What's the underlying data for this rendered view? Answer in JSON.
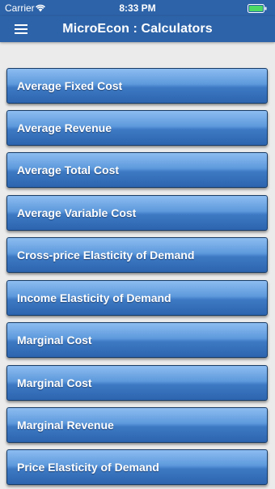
{
  "status_bar": {
    "carrier": "Carrier",
    "time": "8:33 PM",
    "icons": [
      "wifi-icon",
      "battery-icon"
    ]
  },
  "header": {
    "title": "MicroEcon : Calculators",
    "menu_icon": "hamburger-menu-icon"
  },
  "colors": {
    "bar": "#2d63a8",
    "button_top": "#8dbdf1",
    "button_bottom": "#2d64ae",
    "background": "#ebebeb",
    "battery": "#4cd964"
  },
  "calculators": [
    {
      "label": "Average Fixed Cost"
    },
    {
      "label": "Average Revenue"
    },
    {
      "label": "Average Total Cost"
    },
    {
      "label": "Average Variable Cost"
    },
    {
      "label": "Cross-price Elasticity of Demand"
    },
    {
      "label": "Income Elasticity of Demand"
    },
    {
      "label": "Marginal Cost"
    },
    {
      "label": "Marginal Cost"
    },
    {
      "label": "Marginal Revenue"
    },
    {
      "label": "Price Elasticity of Demand"
    }
  ]
}
